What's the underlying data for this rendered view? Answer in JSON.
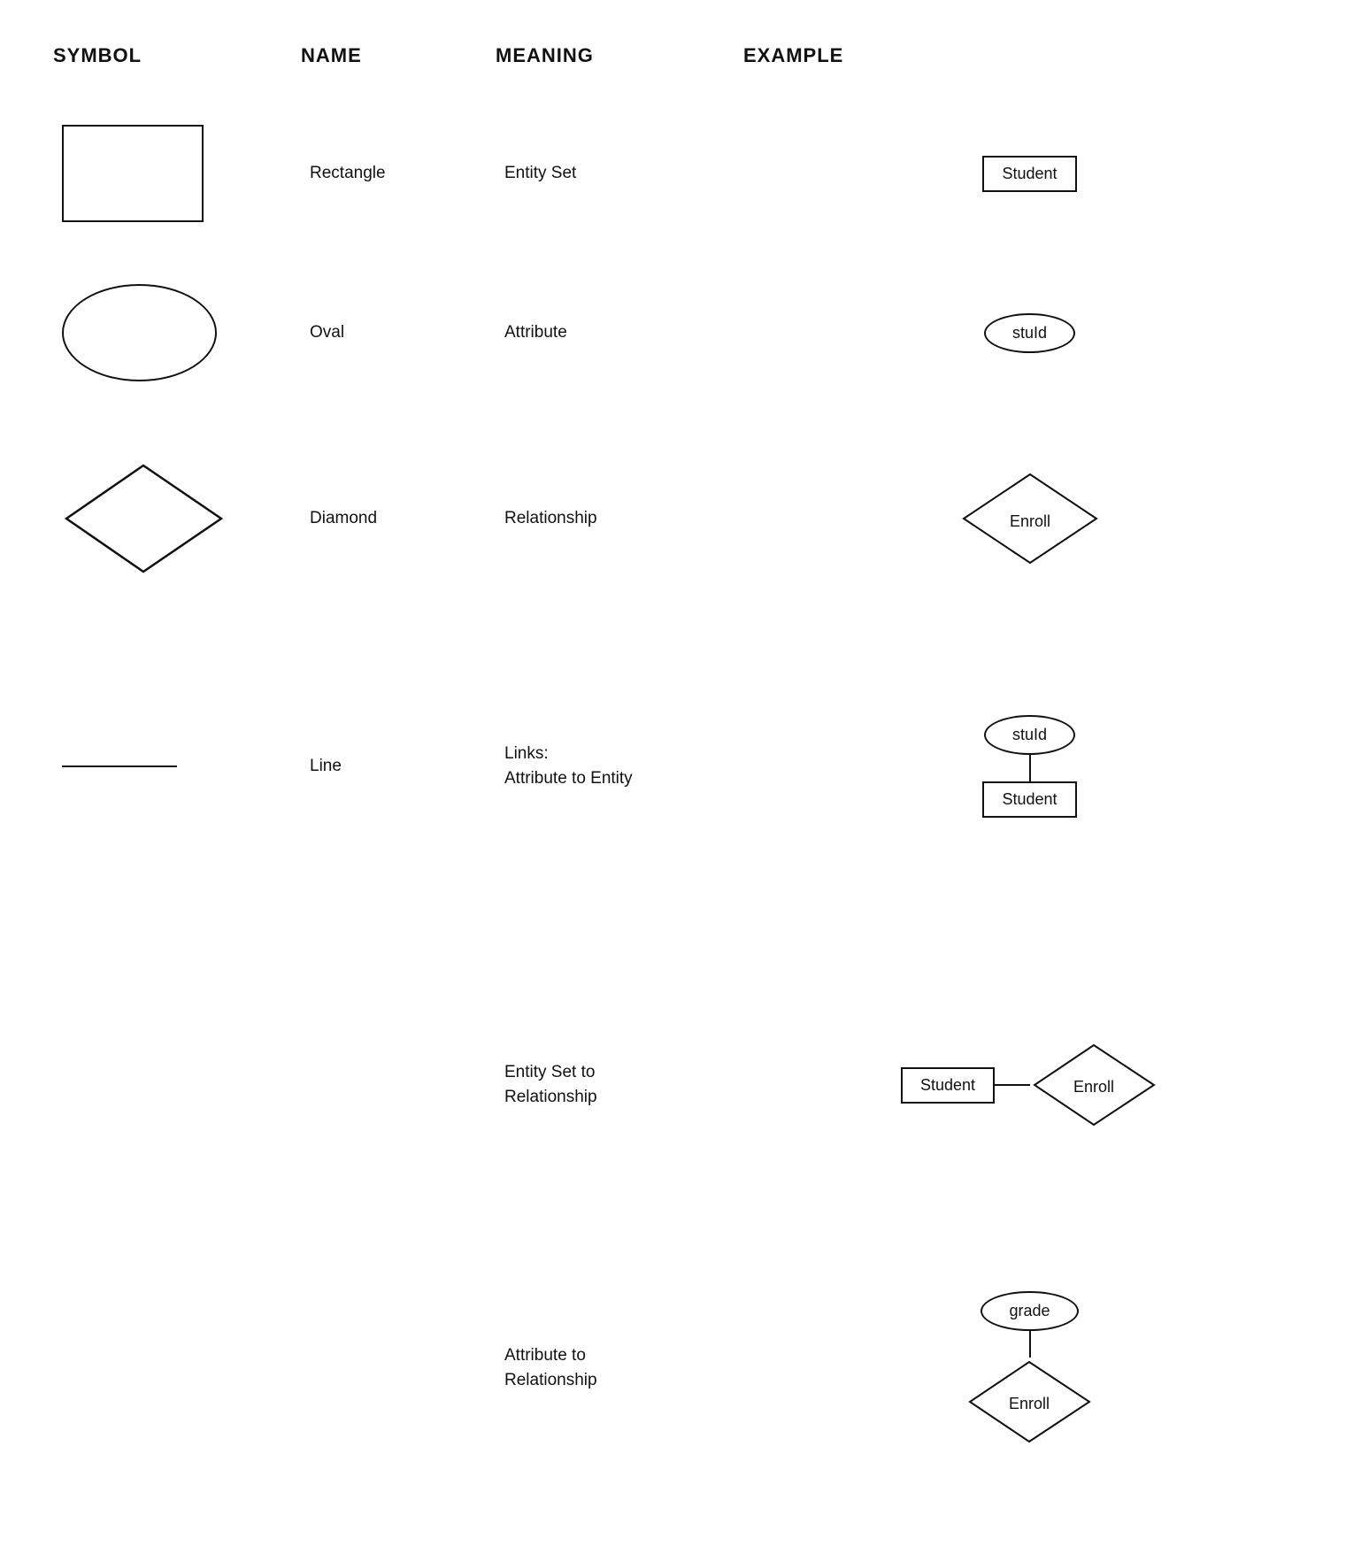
{
  "header": {
    "col1": "SYMBOL",
    "col2": "NAME",
    "col3": "MEANING",
    "col4": "EXAMPLE"
  },
  "rows": [
    {
      "id": "rectangle",
      "name": "Rectangle",
      "meaning": "Entity Set",
      "example_label": "Student"
    },
    {
      "id": "oval",
      "name": "Oval",
      "meaning": "Attribute",
      "example_label": "stuId"
    },
    {
      "id": "diamond",
      "name": "Diamond",
      "meaning": "Relationship",
      "example_label": "Enroll"
    },
    {
      "id": "line",
      "name": "Line",
      "meaning_line1": "Links:",
      "meaning_line2": "Attribute to Entity",
      "example_oval": "stuId",
      "example_rect": "Student"
    }
  ],
  "bottom_rows": [
    {
      "id": "entity-set-to-relationship",
      "meaning_line1": "Entity Set to",
      "meaning_line2": "Relationship",
      "example_rect": "Student",
      "example_diamond": "Enroll"
    },
    {
      "id": "attribute-to-relationship",
      "meaning_line1": "Attribute to",
      "meaning_line2": "Relationship",
      "example_oval": "grade",
      "example_diamond": "Enroll"
    }
  ]
}
